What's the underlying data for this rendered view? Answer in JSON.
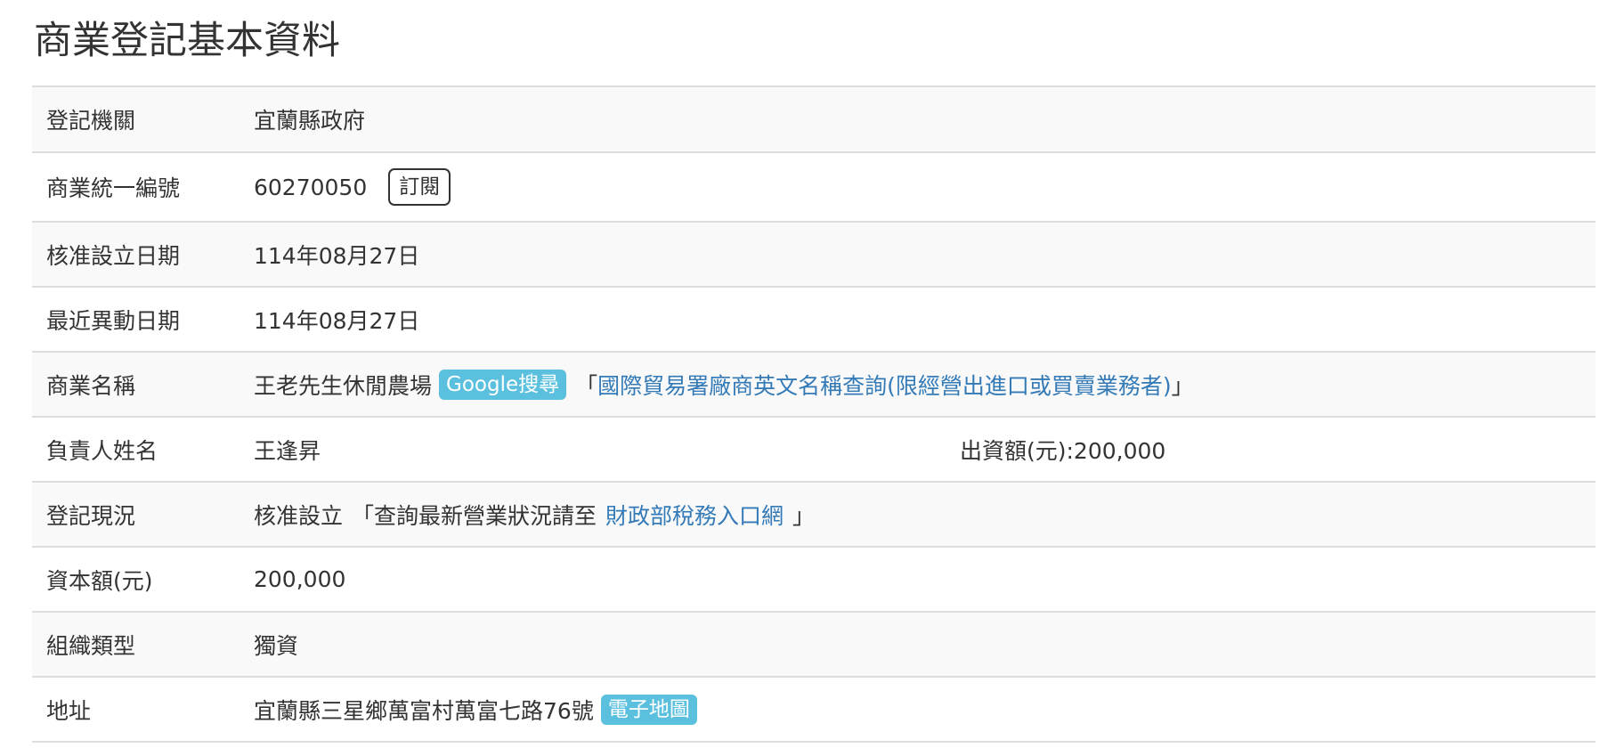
{
  "page": {
    "title": "商業登記基本資料"
  },
  "rows": {
    "authority": {
      "label": "登記機關",
      "value": "宜蘭縣政府"
    },
    "ubn": {
      "label": "商業統一編號",
      "value": "60270050",
      "subscribe_label": "訂閱"
    },
    "founded": {
      "label": "核准設立日期",
      "value": "114年08月27日"
    },
    "changed": {
      "label": "最近異動日期",
      "value": "114年08月27日"
    },
    "name": {
      "label": "商業名稱",
      "value": "王老先生休閒農場",
      "google_label": "Google搜尋",
      "bracket_open": "「",
      "trade_link": "國際貿易署廠商英文名稱查詢(限經營出進口或買賣業務者)",
      "bracket_close": "」"
    },
    "owner": {
      "label": "負責人姓名",
      "value": "王逢昇",
      "investment": "出資額(元):200,000"
    },
    "status": {
      "label": "登記現況",
      "value": "核准設立",
      "note_prefix": "「查詢最新營業狀況請至",
      "tax_link": "財政部稅務入口網",
      "note_suffix": "」"
    },
    "capital": {
      "label": "資本額(元)",
      "value": "200,000"
    },
    "org_type": {
      "label": "組織類型",
      "value": "獨資"
    },
    "address": {
      "label": "地址",
      "value": "宜蘭縣三星鄉萬富村萬富七路76號",
      "map_label": "電子地圖"
    }
  },
  "colors": {
    "badge": "#5bc0de",
    "link": "#337ab7",
    "stripe": "#f9f9f9",
    "border": "#dddddd"
  }
}
